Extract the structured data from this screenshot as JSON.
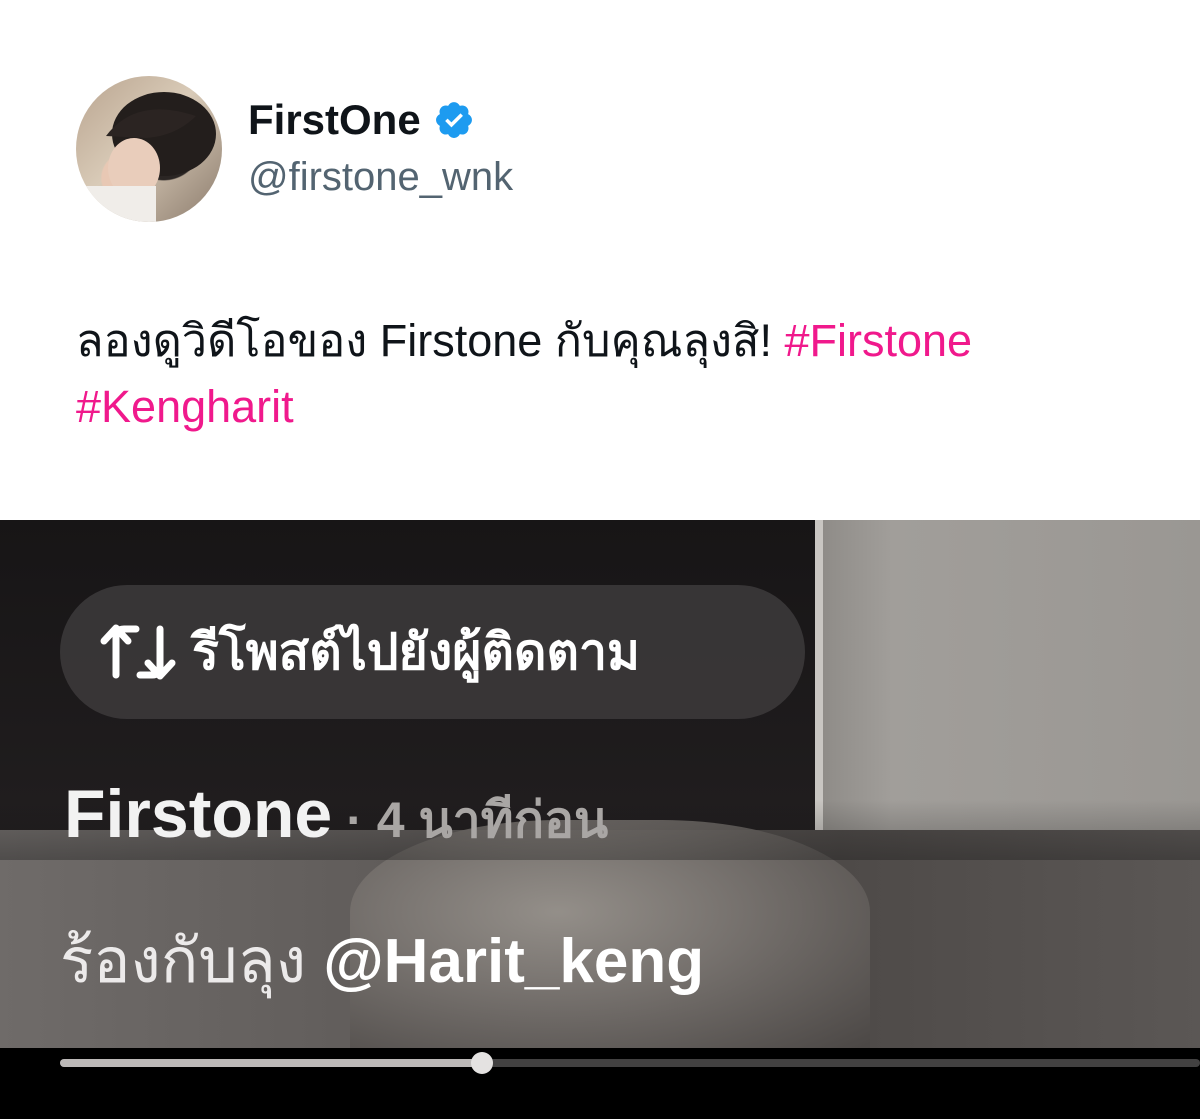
{
  "tweet": {
    "display_name": "FirstOne",
    "verified": true,
    "handle": "@firstone_wnk",
    "text_main": "ลองดูวิดีโอของ Firstone กับคุณลุงสิ! ",
    "hashtags": [
      "#Firstone",
      "#Kengharit"
    ]
  },
  "video": {
    "repost_label": "รีโพสต์ไปยังผู้ติดตาม",
    "author": "Firstone",
    "time": "· 4 นาทีก่อน",
    "caption_text": "ร้องกับลุง ",
    "caption_mention": "@Harit_keng",
    "progress": 0.37
  },
  "icons": {
    "verified": "verified-badge-icon",
    "repost": "repost-icon"
  },
  "colors": {
    "hashtag": "#f0198c",
    "verified": "#1d9bf0",
    "handle": "#536471"
  }
}
